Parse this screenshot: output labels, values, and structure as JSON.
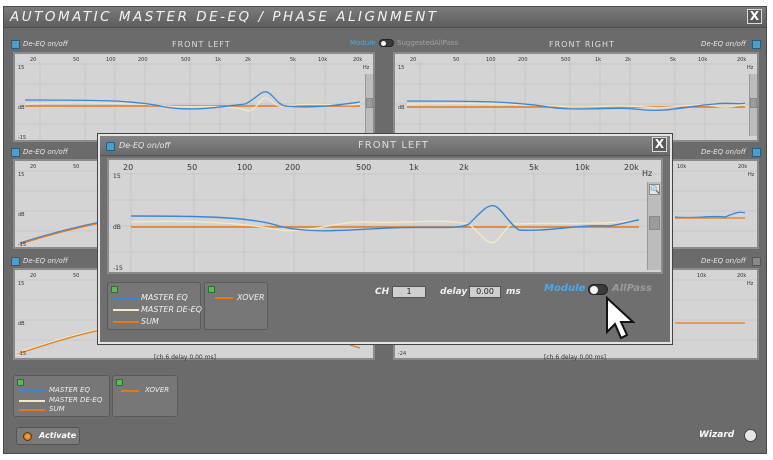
{
  "window": {
    "title": "AUTOMATIC MASTER DE-EQ / PHASE ALIGNMENT",
    "close_label": "X"
  },
  "header": {
    "module_label": "Module",
    "suggested_label": "Suggested",
    "allpass_label": "AllPass"
  },
  "deeq_label": "De-EQ on/off",
  "panels": {
    "front_left": {
      "title": "FRONT LEFT"
    },
    "front_right": {
      "title": "FRONT RIGHT"
    }
  },
  "graph": {
    "freq_ticks": [
      "20",
      "50",
      "100",
      "200",
      "500",
      "1k",
      "2k",
      "5k",
      "10k",
      "20k"
    ],
    "hz": "Hz",
    "db": "dB",
    "top_tick": "15",
    "bottom_tick": "-15",
    "bottom_tick_alt": "-24"
  },
  "delay_text": "[ch 6 delay 0.00 ms]",
  "legend": {
    "master_eq": "MASTER EQ",
    "master_deeq": "MASTER DE-EQ",
    "sum": "SUM",
    "xover": "XOVER"
  },
  "popup": {
    "title": "FRONT LEFT",
    "deeq_label": "De-EQ on/off",
    "close_label": "X",
    "ch_label": "CH",
    "ch_value": "1",
    "delay_label": "delay",
    "delay_value": "0.00",
    "ms_label": "ms",
    "module_label": "Module",
    "allpass_label": "AllPass"
  },
  "footer": {
    "activate_label": "Activate",
    "wizard_label": "Wizard"
  },
  "colors": {
    "master_eq": "#3a86d6",
    "master_deeq": "#f3e9c4",
    "sum": "#e07a1f",
    "xover": "#e07a1f"
  }
}
